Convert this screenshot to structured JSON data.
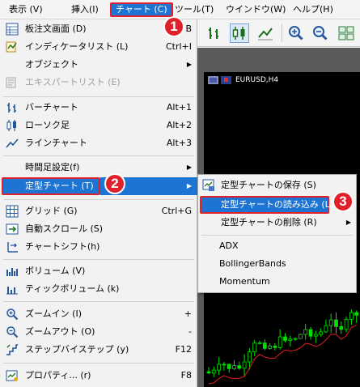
{
  "menubar": {
    "items": [
      {
        "label": "表示 (V)"
      },
      {
        "label": "挿入(I)"
      },
      {
        "label": "チャート (C)"
      },
      {
        "label": "ツール(T)"
      },
      {
        "label": "ウインドウ(W)"
      },
      {
        "label": "ヘルプ(H)"
      }
    ],
    "active_index": 2
  },
  "chart_menu": {
    "items": [
      {
        "label": "板注文画面 (D)",
        "shortcut": "B",
        "icon": "order-board-icon"
      },
      {
        "label": "インディケータリスト (L)",
        "shortcut": "Ctrl+I",
        "icon": "indicator-list-icon"
      },
      {
        "label": "オブジェクト",
        "submenu": true
      },
      {
        "label": "エキスパートリスト (E)",
        "disabled": true,
        "icon": "expert-list-icon"
      },
      {
        "label": "バーチャート",
        "shortcut": "Alt+1",
        "icon": "bar-chart-icon"
      },
      {
        "label": "ローソク足",
        "shortcut": "Alt+2",
        "icon": "candlestick-icon"
      },
      {
        "label": "ラインチャート",
        "shortcut": "Alt+3",
        "icon": "line-chart-icon"
      },
      {
        "label": "時間足設定(f)",
        "submenu": true
      },
      {
        "label": "定型チャート (T)",
        "submenu": true,
        "highlighted": true
      },
      {
        "label": "グリッド (G)",
        "shortcut": "Ctrl+G",
        "icon": "grid-icon"
      },
      {
        "label": "自動スクロール (S)",
        "icon": "auto-scroll-icon"
      },
      {
        "label": "チャートシフト(h)",
        "icon": "chart-shift-icon"
      },
      {
        "label": "ボリューム (V)",
        "icon": "volume-icon"
      },
      {
        "label": "ティックボリューム (k)",
        "icon": "tick-volume-icon"
      },
      {
        "label": "ズームイン (I)",
        "shortcut": "+",
        "icon": "zoom-in-icon"
      },
      {
        "label": "ズームアウト (O)",
        "shortcut": "-",
        "icon": "zoom-out-icon"
      },
      {
        "label": "ステップバイステップ (y)",
        "shortcut": "F12",
        "icon": "step-icon"
      },
      {
        "label": "プロパティ... (r)",
        "shortcut": "F8",
        "icon": "properties-icon"
      }
    ]
  },
  "template_submenu": {
    "items": [
      {
        "label": "定型チャートの保存 (S)",
        "icon": "save-template-icon"
      },
      {
        "label": "定型チャートの読み込み (L)",
        "highlighted": true
      },
      {
        "label": "定型チャートの削除 (R)",
        "submenu": true
      },
      {
        "label": "ADX"
      },
      {
        "label": "BollingerBands"
      },
      {
        "label": "Momentum"
      }
    ]
  },
  "chart_window": {
    "title": "EURUSD,H4"
  },
  "badges": [
    "1",
    "2",
    "3"
  ],
  "colors": {
    "highlight": "#1e74d2",
    "annotation_red": "#e0202a",
    "candle_green": "#00e000",
    "ma_line": "#e02020"
  }
}
